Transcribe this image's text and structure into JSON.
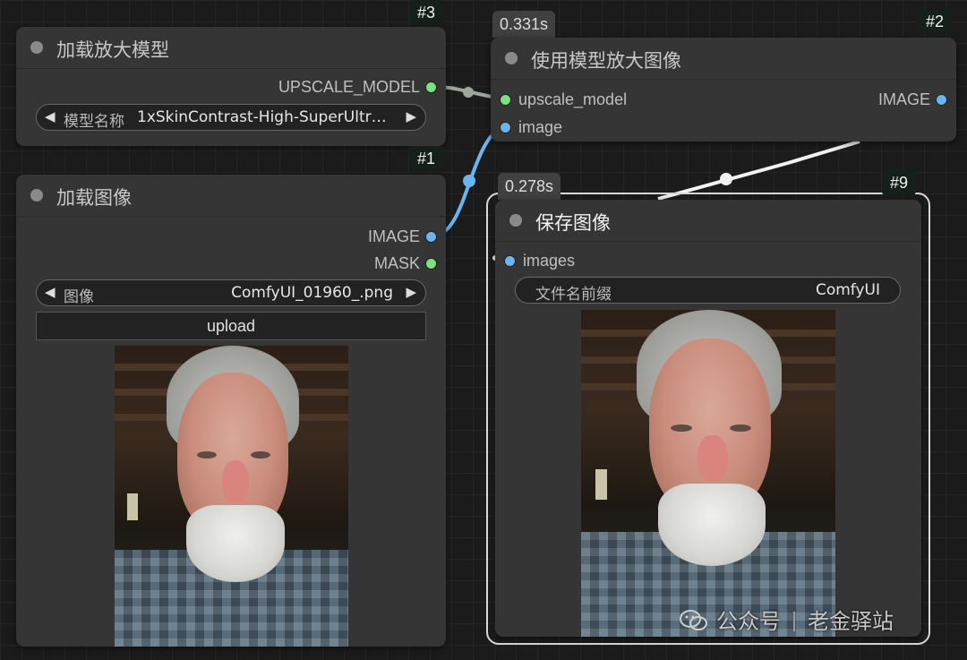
{
  "nodes": {
    "upscale_loader": {
      "id": "#3",
      "title": "加载放大模型",
      "output": "UPSCALE_MODEL",
      "widget": {
        "label": "模型名称",
        "value": "1xSkinContrast-High-SuperUltr…"
      }
    },
    "load_image": {
      "id": "#1",
      "title": "加载图像",
      "outputs": [
        "IMAGE",
        "MASK"
      ],
      "widget": {
        "label": "图像",
        "value": "ComfyUI_01960_.png"
      },
      "upload_label": "upload"
    },
    "upscale_with_model": {
      "id": "#2",
      "timing": "0.331s",
      "title": "使用模型放大图像",
      "inputs": [
        "upscale_model",
        "image"
      ],
      "output": "IMAGE"
    },
    "save_image": {
      "id": "#9",
      "timing": "0.278s",
      "title": "保存图像",
      "input": "images",
      "widget": {
        "label": "文件名前缀",
        "value": "ComfyUI"
      }
    }
  },
  "watermark": {
    "left": "公众号",
    "right": "老金驿站"
  },
  "colors": {
    "model_port": "#7ee07e",
    "image_port": "#6cb4ef",
    "image_link": "#6cb4ef",
    "model_link": "#9aa89a",
    "link_white": "#f2f2f2",
    "node_bg": "#353535",
    "canvas_bg": "#1b1b1b"
  },
  "icons": [
    "arrow-left-icon",
    "arrow-right-icon",
    "wechat-icon"
  ]
}
